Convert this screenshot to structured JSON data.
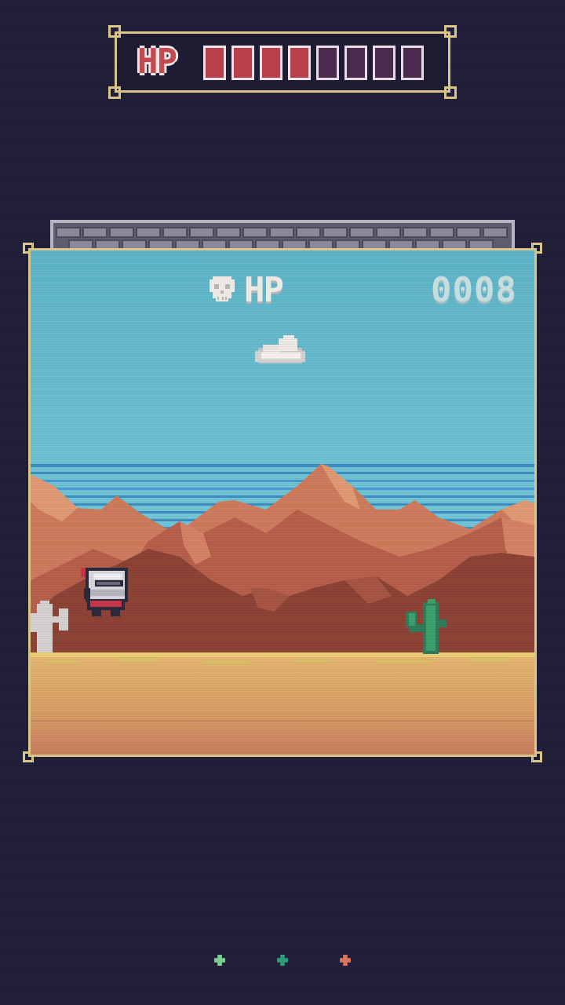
{
  "hp_panel": {
    "label": "HP",
    "max_hearts": 8,
    "current_hearts": 4
  },
  "hud": {
    "hp_label": "HP",
    "score": "0008"
  },
  "colors": {
    "hp_full": "#b8404a",
    "hp_empty": "#4a2a4e",
    "frame_gold": "#d8c58a",
    "sky": "#6bbfd2",
    "sand": "#e2b06d"
  },
  "page_indicator": {
    "count": 3,
    "colors": [
      "#7ccf8e",
      "#2d9a7c",
      "#d9735e"
    ]
  }
}
